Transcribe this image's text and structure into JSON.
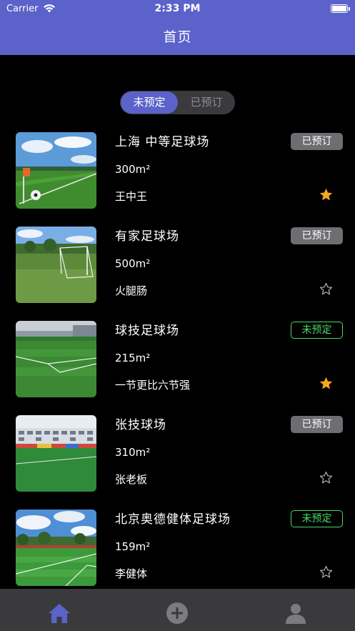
{
  "status_bar": {
    "carrier": "Carrier",
    "time": "2:33 PM"
  },
  "header": {
    "title": "首页"
  },
  "segment": {
    "options": [
      "未预定",
      "已预订"
    ],
    "selected": "未预定"
  },
  "venues": [
    {
      "name": "上海 中等足球场",
      "area": "300m²",
      "owner": "王中王",
      "status": "已预订",
      "favorite": true
    },
    {
      "name": "有家足球场",
      "area": "500m²",
      "owner": "火腿肠",
      "status": "已预订",
      "favorite": false
    },
    {
      "name": "球技足球场",
      "area": "215m²",
      "owner": "一节更比六节强",
      "status": "未预定",
      "favorite": true
    },
    {
      "name": "张技球场",
      "area": "310m²",
      "owner": "张老板",
      "status": "已预订",
      "favorite": false
    },
    {
      "name": "北京奥德健体足球场",
      "area": "159m²",
      "owner": "李健体",
      "status": "未预定",
      "favorite": false
    }
  ],
  "tabbar": {
    "items": [
      "home-icon",
      "add-circle-icon",
      "profile-icon"
    ],
    "selected": "home-icon"
  },
  "colors": {
    "accent": "#5b62c9",
    "free_status": "#4cd964",
    "booked_badge": "#6d6d72",
    "star_filled": "#f5a623"
  }
}
